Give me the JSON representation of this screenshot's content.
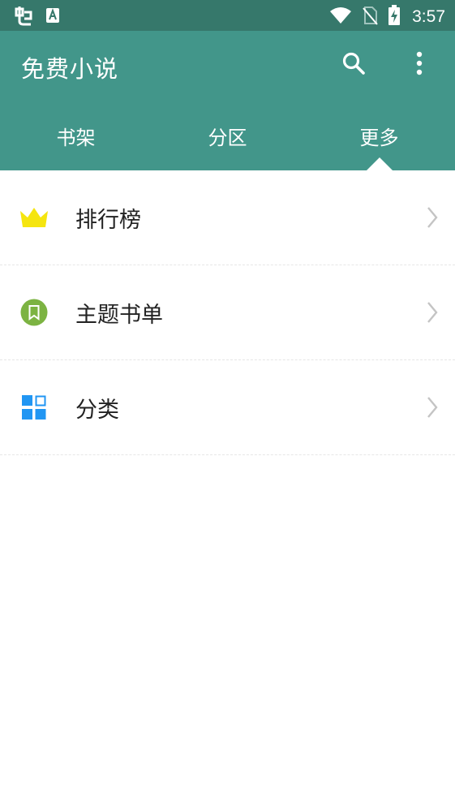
{
  "status_bar": {
    "time": "3:57",
    "icons": [
      "app-logo-icon",
      "notification-a-icon",
      "wifi-icon",
      "no-sim-icon",
      "battery-charging-icon"
    ]
  },
  "app_bar": {
    "title": "免费小说",
    "actions": [
      "search-icon",
      "more-vert-icon"
    ]
  },
  "tabs": [
    {
      "label": "书架"
    },
    {
      "label": "分区"
    },
    {
      "label": "更多",
      "selected": true
    }
  ],
  "menu": {
    "items": [
      {
        "label": "排行榜",
        "icon": "crown-icon",
        "icon_color": "#f5e50f"
      },
      {
        "label": "主题书单",
        "icon": "bookmark-circle-icon",
        "icon_color": "#7cb342"
      },
      {
        "label": "分类",
        "icon": "category-grid-icon",
        "icon_color": "#2196f3"
      }
    ]
  },
  "colors": {
    "status_bar": "#36786b",
    "app_bar": "#42968a",
    "text_primary": "#222222",
    "chevron": "#c4c4c4"
  }
}
